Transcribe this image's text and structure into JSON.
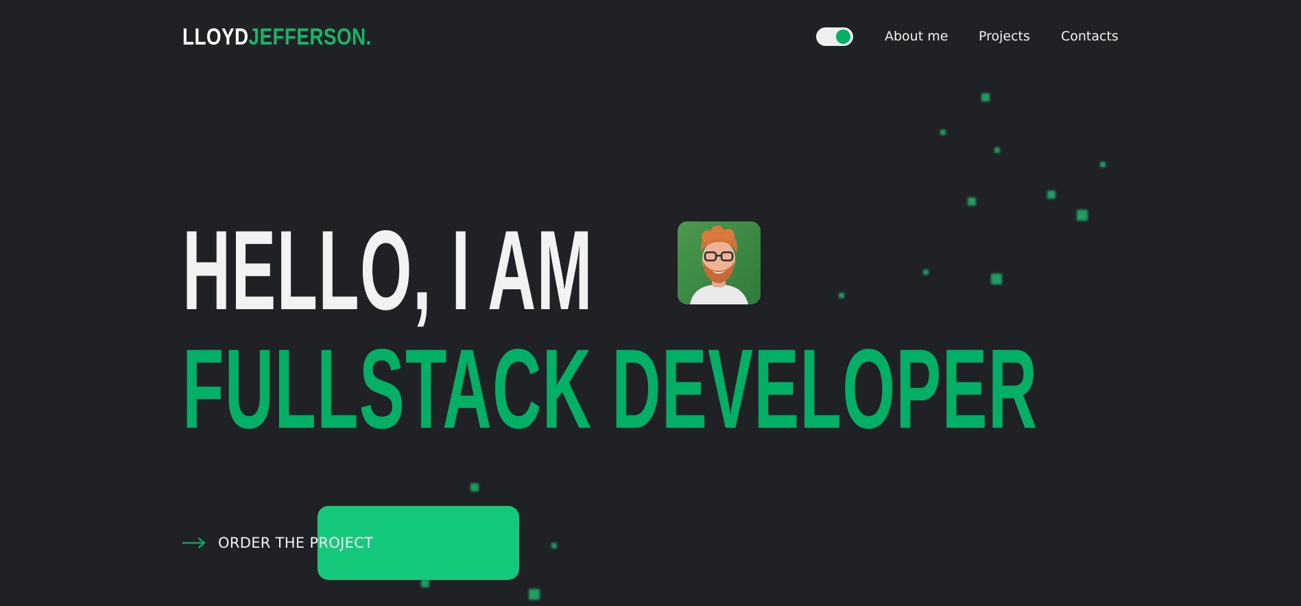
{
  "header": {
    "logo_part1": "LLOYD",
    "logo_part2": "JEFFERSON.",
    "theme_toggle_state": "on",
    "nav": [
      "About me",
      "Projects",
      "Contacts"
    ]
  },
  "hero": {
    "line1": "HELLO, I AM",
    "line2": "FULLSTACK DEVELOPER",
    "avatar_icon": "developer-portrait"
  },
  "cta": {
    "label": "ORDER THE PROJECT",
    "icon": "arrow-right-icon"
  },
  "colors": {
    "background": "#202124",
    "accent": "#00b065",
    "cta_block": "#15c97b",
    "text": "#f2f2f2"
  }
}
